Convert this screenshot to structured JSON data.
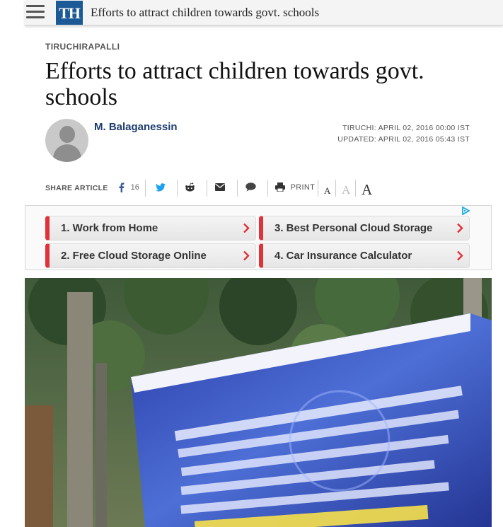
{
  "topbar": {
    "logo_text": "TH",
    "title": "Efforts to attract children towards govt. schools"
  },
  "article": {
    "section": "TIRUCHIRAPALLI",
    "headline": "Efforts to attract children towards govt. schools",
    "author": "M. Balaganessin",
    "published": "TIRUCHI: APRIL 02, 2016 00:00 IST",
    "updated": "UPDATED: APRIL 02, 2016 05:43 IST"
  },
  "share": {
    "label": "SHARE ARTICLE",
    "facebook_count": "16",
    "print_label": "PRINT",
    "font_small": "A",
    "font_medium": "A",
    "font_large": "A",
    "icons": [
      "facebook-icon",
      "twitter-icon",
      "reddit-icon",
      "email-icon",
      "comment-icon",
      "printer-icon"
    ]
  },
  "ads": {
    "items": [
      {
        "label": "1.  Work from Home"
      },
      {
        "label": "3.  Best Personal Cloud Storage"
      },
      {
        "label": "2.  Free Cloud Storage Online"
      },
      {
        "label": "4.  Car Insurance Calculator"
      }
    ],
    "accent": "#e03238"
  },
  "colors": {
    "brand_blue": "#1b5a97",
    "author_blue": "#1b3b6f",
    "twitter_blue": "#1da1f2"
  }
}
